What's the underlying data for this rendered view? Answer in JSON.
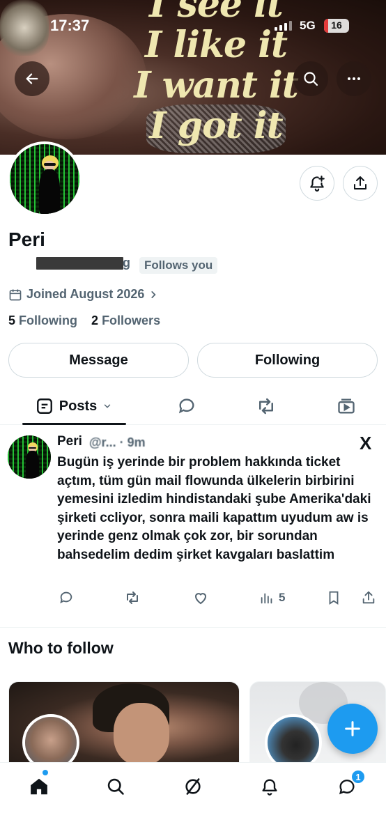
{
  "status_bar": {
    "time": "17:37",
    "network": "5G",
    "battery": "16"
  },
  "banner": {
    "lines": [
      "I see it",
      "I like it",
      "I want it",
      "I got it"
    ]
  },
  "profile": {
    "name": "Peri",
    "handle_tail": "g",
    "follows_you": "Follows you",
    "joined": "Joined August 2026",
    "following_count": "5",
    "following_label": "Following",
    "followers_count": "2",
    "followers_label": "Followers"
  },
  "buttons": {
    "message": "Message",
    "following": "Following"
  },
  "tabs": {
    "posts": "Posts"
  },
  "post": {
    "author": "Peri",
    "meta": "@r... · 9m",
    "text": "Bugün iş yerinde bir problem hakkında ticket açtım, tüm gün mail flowunda ülkelerin birbirini yemesini izledim hindistandaki şube Amerika'daki şirketi ccliyor, sonra maili kapattım uyudum aw is yerinde genz olmak çok zor, bir sorundan bahsedelim dedim şirket kavgaları baslattim",
    "views": "5",
    "x_mark": "X"
  },
  "who_to_follow": {
    "title": "Who to follow"
  },
  "bottom_nav": {
    "messages_badge": "1"
  },
  "colors": {
    "accent": "#1d9bf0",
    "text": "#0f1419",
    "muted": "#536471",
    "border": "#cfd9de"
  }
}
